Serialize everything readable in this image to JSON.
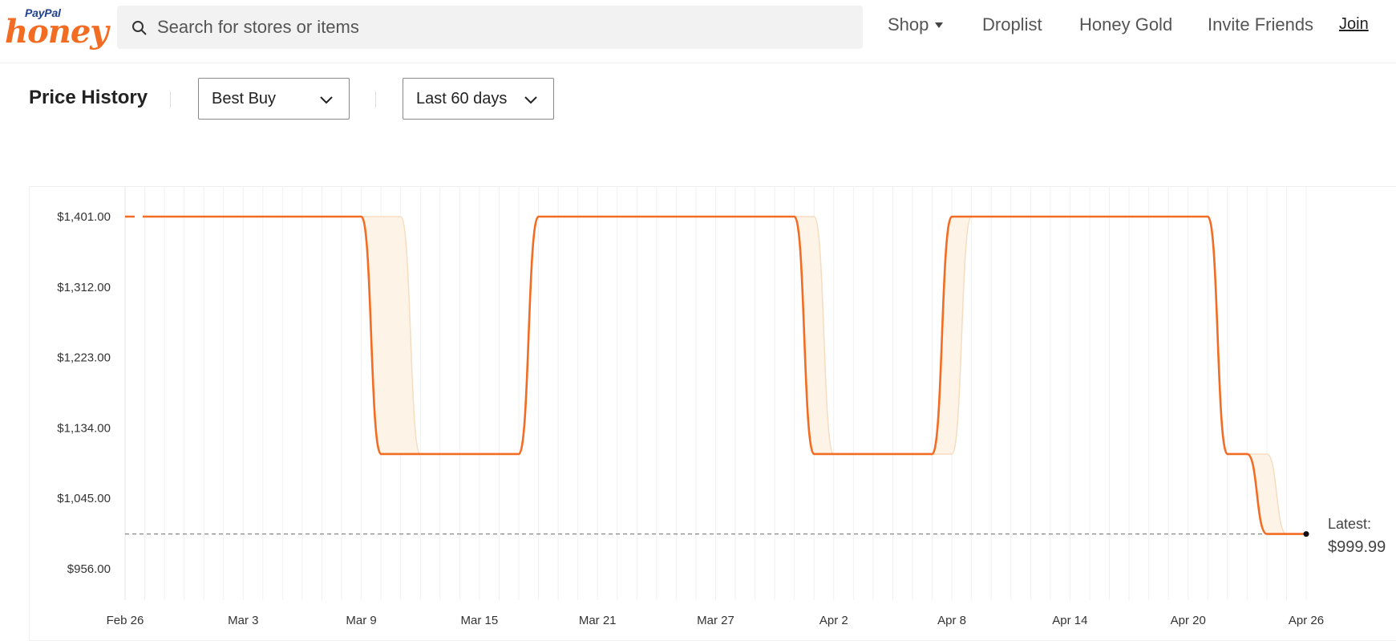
{
  "header": {
    "logo_top": "PayPal",
    "logo_main": "honey",
    "search_placeholder": "Search for stores or items",
    "nav": {
      "shop": "Shop",
      "droplist": "Droplist",
      "honey_gold": "Honey Gold",
      "invite": "Invite Friends",
      "join": "Join"
    }
  },
  "controls": {
    "title": "Price History",
    "store": "Best Buy",
    "range": "Last 60 days"
  },
  "colors": {
    "accent": "#f26c23",
    "band": "#fdf3e6",
    "band_edge": "#f6dcc0"
  },
  "chart_data": {
    "type": "line",
    "x_tick_labels": [
      "Feb 26",
      "Mar 3",
      "Mar 9",
      "Mar 15",
      "Mar 21",
      "Mar 27",
      "Apr 2",
      "Apr 8",
      "Apr 14",
      "Apr 20",
      "Apr 26"
    ],
    "y_tick_labels": [
      "$1,401.00",
      "$1,312.00",
      "$1,223.00",
      "$1,134.00",
      "$1,045.00",
      "$956.00"
    ],
    "y_ticks": [
      1401,
      1312,
      1223,
      1134,
      1045,
      956
    ],
    "ylim": [
      925,
      1435
    ],
    "x_range": [
      "2024-02-26",
      "2024-04-26"
    ],
    "series": [
      {
        "x": [
          "2024-02-26",
          "2024-03-09",
          "2024-03-10",
          "2024-03-17",
          "2024-03-18",
          "2024-03-31",
          "2024-04-01",
          "2024-04-07",
          "2024-04-08",
          "2024-04-21",
          "2024-04-22",
          "2024-04-23",
          "2024-04-24",
          "2024-04-26"
        ],
        "y": [
          1401,
          1401,
          1101,
          1101,
          1401,
          1401,
          1101,
          1101,
          1401,
          1401,
          1101,
          1101,
          1000,
          999.99
        ]
      }
    ],
    "band_upper": {
      "x": [
        "2024-02-26",
        "2024-03-11",
        "2024-03-12",
        "2024-03-17",
        "2024-03-18",
        "2024-04-01",
        "2024-04-02",
        "2024-04-08",
        "2024-04-09",
        "2024-04-21",
        "2024-04-22",
        "2024-04-24",
        "2024-04-25",
        "2024-04-26"
      ],
      "y": [
        1401,
        1401,
        1101,
        1101,
        1401,
        1401,
        1101,
        1101,
        1401,
        1401,
        1101,
        1101,
        1000,
        999.99
      ]
    },
    "latest_label": "Latest:",
    "latest_value": "$999.99",
    "reference_line": 999.99,
    "grid": true
  }
}
